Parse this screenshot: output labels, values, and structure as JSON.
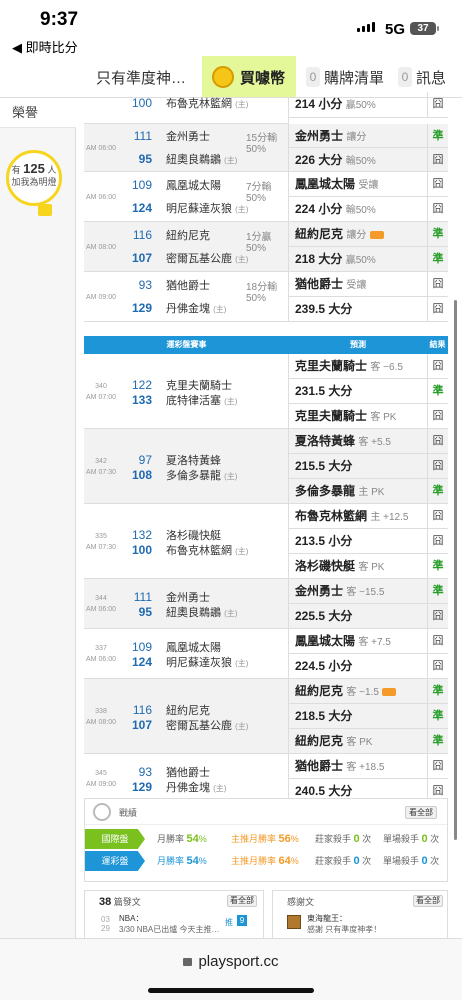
{
  "status": {
    "time": "9:37",
    "back": "◀ 即時比分",
    "network": "5G",
    "battery": "37"
  },
  "tabs": {
    "prediction": "只有準度神…",
    "buy": "買噱幣",
    "buy_zero": "",
    "purchase_count": "0",
    "purchase": "購牌清單",
    "msg_count": "0",
    "msg": "訊息"
  },
  "sidebar": {
    "title": "榮譽",
    "bulb_pre": "有",
    "bulb_count": "125",
    "bulb_unit": "人",
    "bulb_text": "加我為明燈"
  },
  "top_rows": [
    {
      "time": "",
      "t1n": "",
      "t1": "",
      "t2n": "100",
      "t2": "布魯克林籃網",
      "extra": "",
      "extra2": "",
      "p1": "",
      "p2": "214 小分",
      "p2note": "贏50%",
      "r1": "",
      "r2": "囧"
    },
    {
      "time": "AM 06:00",
      "t1n": "111",
      "t1": "金州勇士",
      "t2n": "95",
      "t2": "紐奧良鵜鶘",
      "extra": "15分輸",
      "extra2": "50%",
      "p1": "金州勇士",
      "p1note": "讓分",
      "p2": "226 大分",
      "p2note": "輸50%",
      "r1": "準",
      "r2": "囧"
    },
    {
      "time": "AM 06:00",
      "t1n": "109",
      "t1": "鳳凰城太陽",
      "t2n": "124",
      "t2": "明尼蘇達灰狼",
      "extra": "7分輸",
      "extra2": "50%",
      "p1": "鳳凰城太陽",
      "p1note": "受讓",
      "p2": "224 小分",
      "p2note": "輸50%",
      "r1": "囧",
      "r2": "囧"
    },
    {
      "time": "AM 08:00",
      "t1n": "116",
      "t1": "紐約尼克",
      "t2n": "107",
      "t2": "密爾瓦基公鹿",
      "extra": "1分贏",
      "extra2": "50%",
      "p1": "紐約尼克",
      "p1note": "讓分",
      "p2": "218 大分",
      "p2note": "贏50%",
      "r1": "準",
      "r2": "準"
    },
    {
      "time": "AM 09:00",
      "t1n": "93",
      "t1": "猶他爵士",
      "t2n": "129",
      "t2": "丹佛金塊",
      "extra": "18分輸",
      "extra2": "50%",
      "p1": "猶他爵士",
      "p1note": "受讓",
      "p2": "239.5 大分",
      "p2note": "",
      "r1": "囧",
      "r2": "囧"
    }
  ],
  "section": {
    "title": "運彩盤賽事",
    "pred": "預測",
    "result": "結果"
  },
  "sports_rows": [
    {
      "id": "340",
      "time": "AM 07:00",
      "t1n": "122",
      "t1": "克里夫蘭騎士",
      "t2n": "133",
      "t2": "底特律活塞",
      "preds": [
        {
          "t": "克里夫蘭騎士",
          "note": "客 −6.5",
          "r": "囧"
        },
        {
          "t": "231.5 大分",
          "note": "",
          "r": "準"
        },
        {
          "t": "克里夫蘭騎士",
          "note": "客 PK",
          "r": "囧"
        }
      ]
    },
    {
      "id": "342",
      "time": "AM 07:30",
      "t1n": "97",
      "t1": "夏洛特黃蜂",
      "t2n": "108",
      "t2": "多倫多暴龍",
      "preds": [
        {
          "t": "夏洛特黃蜂",
          "note": "客 +5.5",
          "r": "囧"
        },
        {
          "t": "215.5 大分",
          "note": "",
          "r": "囧"
        },
        {
          "t": "多倫多暴龍",
          "note": "主 PK",
          "r": "準"
        }
      ]
    },
    {
      "id": "335",
      "time": "AM 07:30",
      "t1n": "132",
      "t1": "洛杉磯快艇",
      "t2n": "100",
      "t2": "布魯克林籃網",
      "preds": [
        {
          "t": "布魯克林籃網",
          "note": "主 +12.5",
          "r": "囧"
        },
        {
          "t": "213.5 小分",
          "note": "",
          "r": "囧"
        },
        {
          "t": "洛杉磯快艇",
          "note": "客 PK",
          "r": "準"
        }
      ]
    },
    {
      "id": "344",
      "time": "AM 06:00",
      "t1n": "111",
      "t1": "金州勇士",
      "t2n": "95",
      "t2": "紐奧良鵜鶘",
      "preds": [
        {
          "t": "金州勇士",
          "note": "客 −15.5",
          "r": "準"
        },
        {
          "t": "225.5 大分",
          "note": "",
          "r": "囧"
        }
      ]
    },
    {
      "id": "337",
      "time": "AM 06:00",
      "t1n": "109",
      "t1": "鳳凰城太陽",
      "t2n": "124",
      "t2": "明尼蘇達灰狼",
      "preds": [
        {
          "t": "鳳凰城太陽",
          "note": "客 +7.5",
          "r": "囧"
        },
        {
          "t": "224.5 小分",
          "note": "",
          "r": "囧"
        }
      ]
    },
    {
      "id": "338",
      "time": "AM 08:00",
      "t1n": "116",
      "t1": "紐約尼克",
      "t2n": "107",
      "t2": "密爾瓦基公鹿",
      "preds": [
        {
          "t": "紐約尼克",
          "note": "客 −1.5",
          "r": "準"
        },
        {
          "t": "218.5 大分",
          "note": "",
          "r": "準"
        },
        {
          "t": "紐約尼克",
          "note": "客 PK",
          "r": "準"
        }
      ]
    },
    {
      "id": "345",
      "time": "AM 09:00",
      "t1n": "93",
      "t1": "猶他爵士",
      "t2n": "129",
      "t2": "丹佛金塊",
      "preds": [
        {
          "t": "猶他爵士",
          "note": "客 +18.5",
          "r": "囧"
        },
        {
          "t": "240.5 大分",
          "note": "",
          "r": "囧"
        }
      ]
    }
  ],
  "record": {
    "title": "戰績",
    "view_all": "看全部",
    "rows": [
      {
        "label": "國際盤",
        "s1": "月勝率",
        "v1": "54",
        "u1": "%",
        "s2": "主推月勝率",
        "v2": "56",
        "u2": "%",
        "s3": "莊家殺手",
        "v3": "0",
        "u3": "次",
        "s4": "單場殺手",
        "v4": "0",
        "u4": "次"
      },
      {
        "label": "運彩盤",
        "s1": "月勝率",
        "v1": "54",
        "u1": "%",
        "s2": "主推月勝率",
        "v2": "64",
        "u2": "%",
        "s3": "莊家殺手",
        "v3": "0",
        "u3": "次",
        "s4": "單場殺手",
        "v4": "0",
        "u4": "次"
      }
    ]
  },
  "posts": {
    "count": "38",
    "title": "篇發文",
    "view_all": "看全部",
    "date_top": "03",
    "date_bottom": "29",
    "post_title": "NBA：",
    "post_text": "3/30 NBA已出爐 今天主推…",
    "tag": "推",
    "num": "9"
  },
  "followers": {
    "title": "感謝文",
    "view_all": "看全部",
    "name": "東海龍王：",
    "text": "感謝 只有準度神孝！"
  },
  "browser": {
    "url": "playsport.cc"
  }
}
